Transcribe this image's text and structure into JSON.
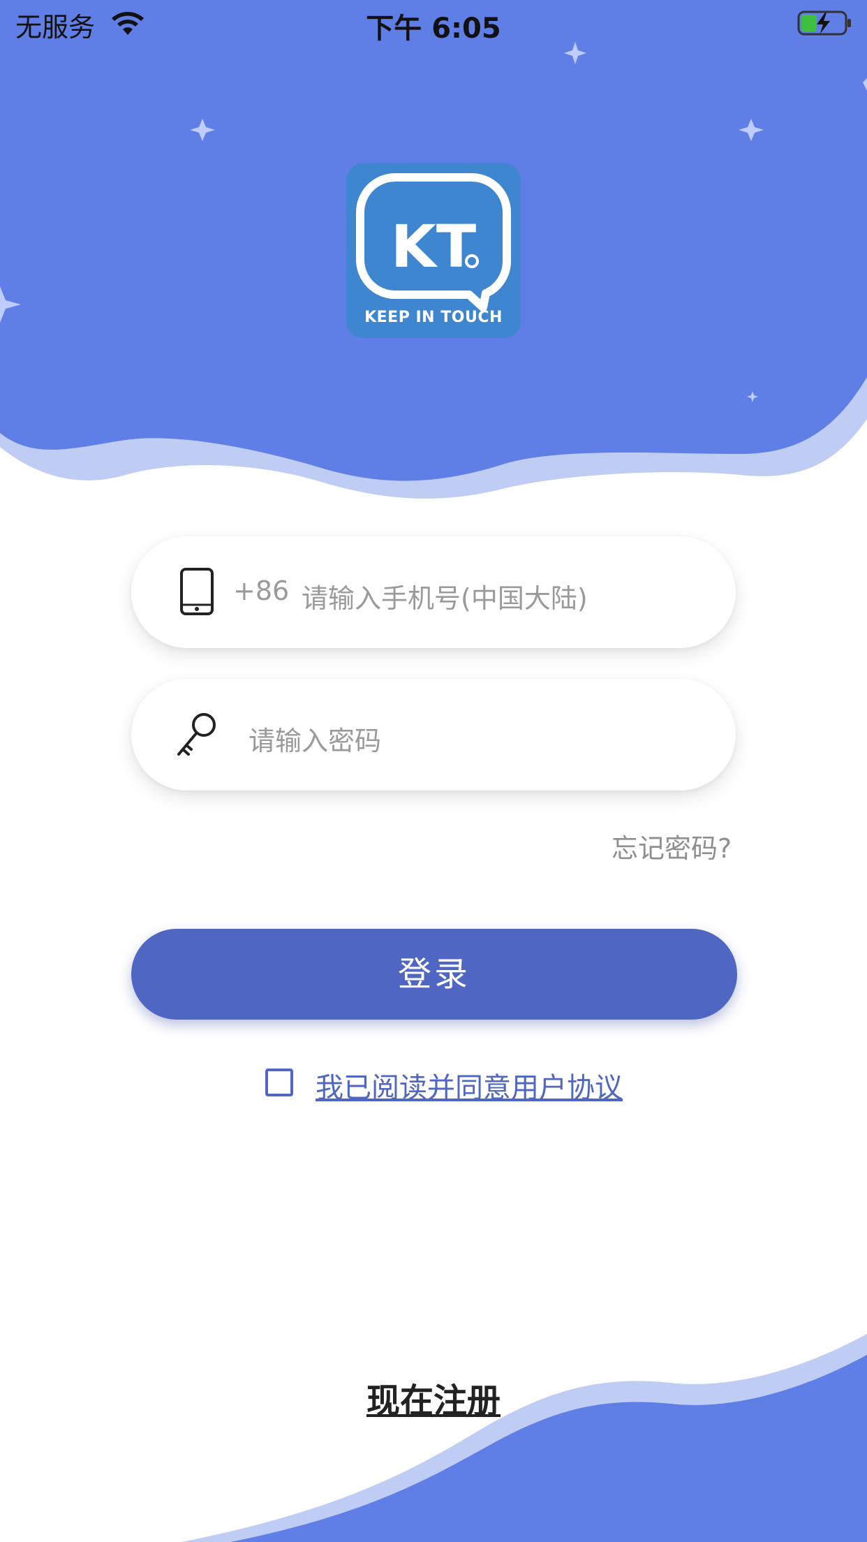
{
  "status_bar": {
    "carrier": "无服务",
    "time": "下午 6:05"
  },
  "logo": {
    "caption": "KEEP IN TOUCH",
    "letters": "KT"
  },
  "phone_field": {
    "prefix": "+86",
    "placeholder": "请输入手机号(中国大陆)"
  },
  "password_field": {
    "placeholder": "请输入密码"
  },
  "forgot_password": "忘记密码?",
  "login_button": "登录",
  "agreement": {
    "checked": false,
    "text": "我已阅读并同意用户协议"
  },
  "register_link": "现在注册",
  "colors": {
    "primary": "#4f66c2",
    "header_blue": "#5f7ee6",
    "light_wave": "#bfcdf5",
    "logo_bg": "#3f86d1"
  }
}
